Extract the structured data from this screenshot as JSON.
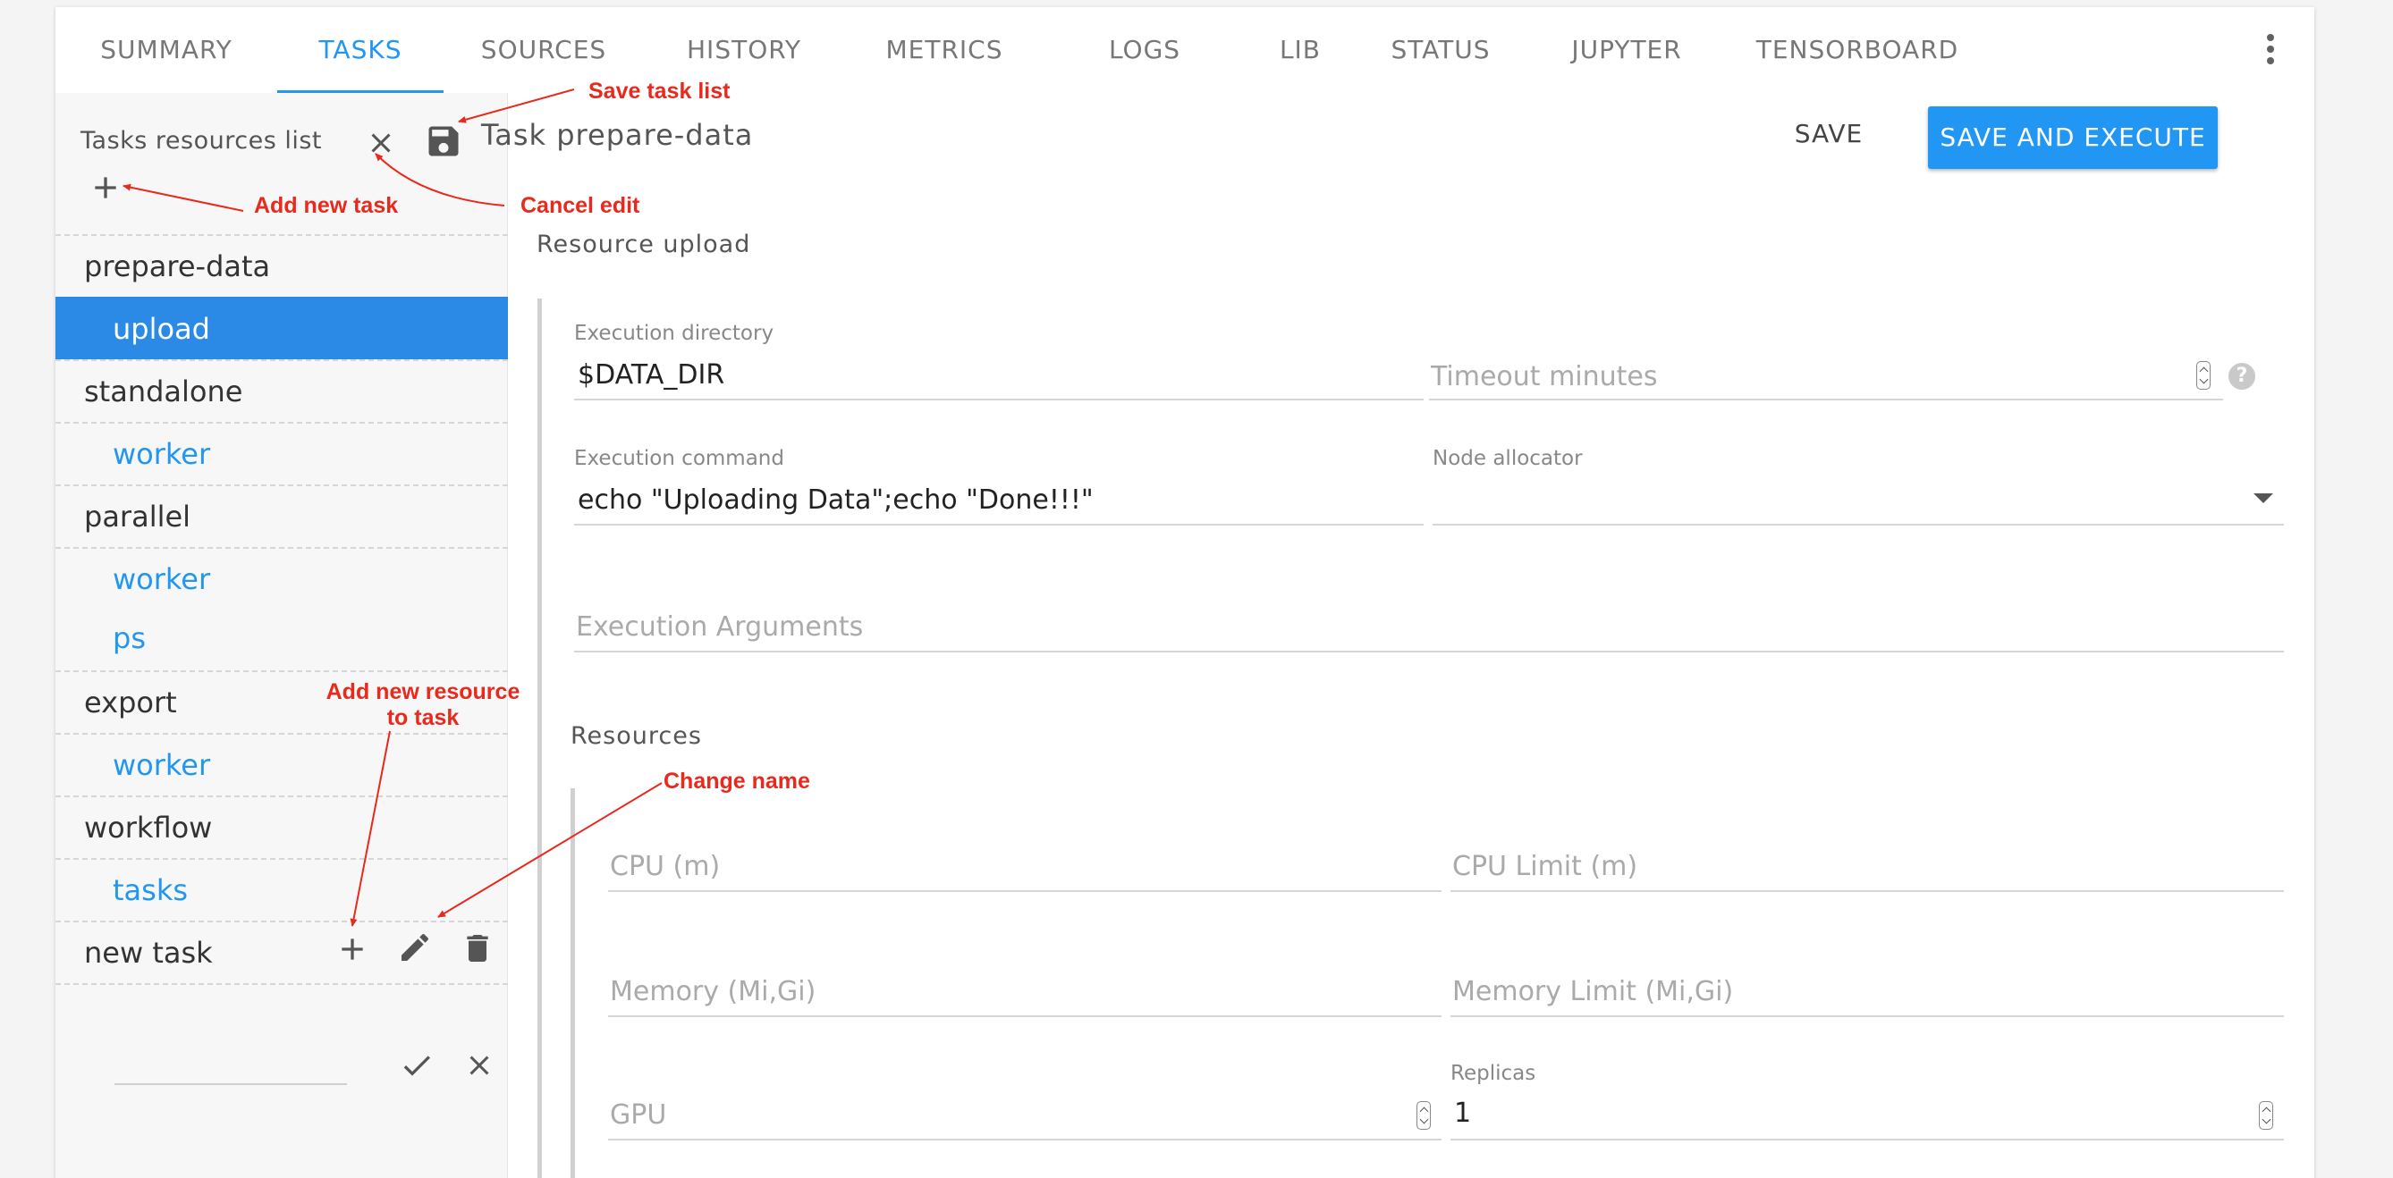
{
  "tabs": [
    {
      "label": "SUMMARY"
    },
    {
      "label": "TASKS"
    },
    {
      "label": "SOURCES"
    },
    {
      "label": "HISTORY"
    },
    {
      "label": "METRICS"
    },
    {
      "label": "LOGS"
    },
    {
      "label": "LIB"
    },
    {
      "label": "STATUS"
    },
    {
      "label": "JUPYTER"
    },
    {
      "label": "TENSORBOARD"
    }
  ],
  "active_tab": "TASKS",
  "left_panel": {
    "title": "Tasks resources list",
    "tree": [
      {
        "label": "prepare-data",
        "kind": "task"
      },
      {
        "label": "upload",
        "kind": "resource",
        "selected": true
      },
      {
        "label": "standalone",
        "kind": "task"
      },
      {
        "label": "worker",
        "kind": "resource"
      },
      {
        "label": "parallel",
        "kind": "task"
      },
      {
        "label": "worker",
        "kind": "resource"
      },
      {
        "label": "ps",
        "kind": "resource"
      },
      {
        "label": "export",
        "kind": "task"
      },
      {
        "label": "worker",
        "kind": "resource"
      },
      {
        "label": "workflow",
        "kind": "task"
      },
      {
        "label": "tasks",
        "kind": "resource"
      },
      {
        "label": "new task",
        "kind": "task"
      }
    ],
    "new_item_input": {
      "value": ""
    }
  },
  "content": {
    "title": "Task prepare-data",
    "save_label": "SAVE",
    "save_execute_label": "SAVE AND EXECUTE",
    "resource_section": "Resource upload",
    "execution_directory": {
      "label": "Execution directory",
      "value": "$DATA_DIR"
    },
    "timeout_minutes": {
      "placeholder": "Timeout minutes"
    },
    "execution_command": {
      "label": "Execution command",
      "value": "echo \"Uploading Data\";echo \"Done!!!\""
    },
    "node_allocator": {
      "label": "Node allocator",
      "value": ""
    },
    "execution_arguments": {
      "placeholder": "Execution Arguments"
    },
    "resources_section": "Resources",
    "cpu": {
      "placeholder": "CPU (m)"
    },
    "cpu_limit": {
      "placeholder": "CPU Limit (m)"
    },
    "memory": {
      "placeholder": "Memory (Mi,Gi)"
    },
    "memory_limit": {
      "placeholder": "Memory Limit (Mi,Gi)"
    },
    "gpu": {
      "placeholder": "GPU"
    },
    "replicas": {
      "label": "Replicas",
      "value": "1"
    }
  },
  "annotations": {
    "save_task_list": "Save task list",
    "add_new_task": "Add new task",
    "cancel_edit": "Cancel edit",
    "add_new_resource_line1": "Add new resource",
    "add_new_resource_line2": "to task",
    "change_name": "Change name"
  },
  "colors": {
    "accent": "#2196f3",
    "selected_row": "#2a8ae6",
    "annotation": "#e8291c"
  }
}
